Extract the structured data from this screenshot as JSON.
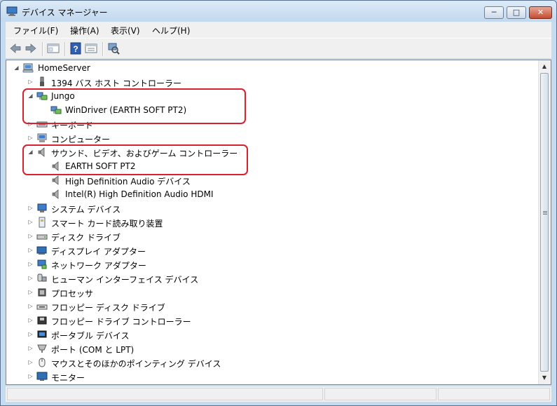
{
  "window": {
    "title": "デバイス マネージャー",
    "minimize_glyph": "─",
    "maximize_glyph": "□",
    "close_glyph": "✕"
  },
  "menu": [
    "ファイル(F)",
    "操作(A)",
    "表示(V)",
    "ヘルプ(H)"
  ],
  "toolbar": {
    "buttons": [
      "back-arrow-icon",
      "forward-arrow-icon",
      "console-tree-icon",
      "help-icon",
      "properties-icon",
      "scan-hardware-icon"
    ]
  },
  "tree": {
    "root": "HomeServer",
    "items": [
      {
        "label": "1394 バス ホスト コントローラー",
        "level": 1,
        "expander": "▷",
        "icon": "bus-controller-icon"
      },
      {
        "label": "Jungo",
        "level": 1,
        "expander": "◢",
        "icon": "network-icon"
      },
      {
        "label": "WinDriver (EARTH SOFT PT2)",
        "level": 2,
        "expander": "",
        "icon": "network-icon"
      },
      {
        "label": "キーボード",
        "level": 1,
        "expander": "▷",
        "icon": "keyboard-icon"
      },
      {
        "label": "コンピューター",
        "level": 1,
        "expander": "▷",
        "icon": "computer-icon"
      },
      {
        "label": "サウンド、ビデオ、およびゲーム コントローラー",
        "level": 1,
        "expander": "◢",
        "icon": "speaker-icon"
      },
      {
        "label": "EARTH SOFT PT2",
        "level": 2,
        "expander": "",
        "icon": "speaker-icon"
      },
      {
        "label": "High Definition Audio デバイス",
        "level": 2,
        "expander": "",
        "icon": "speaker-icon"
      },
      {
        "label": "Intel(R) High Definition Audio HDMI",
        "level": 2,
        "expander": "",
        "icon": "speaker-icon"
      },
      {
        "label": "システム デバイス",
        "level": 1,
        "expander": "▷",
        "icon": "system-device-icon"
      },
      {
        "label": "スマート カード読み取り装置",
        "level": 1,
        "expander": "▷",
        "icon": "smartcard-icon"
      },
      {
        "label": "ディスク ドライブ",
        "level": 1,
        "expander": "▷",
        "icon": "disk-drive-icon"
      },
      {
        "label": "ディスプレイ アダプター",
        "level": 1,
        "expander": "▷",
        "icon": "display-adapter-icon"
      },
      {
        "label": "ネットワーク アダプター",
        "level": 1,
        "expander": "▷",
        "icon": "network-adapter-icon"
      },
      {
        "label": "ヒューマン インターフェイス デバイス",
        "level": 1,
        "expander": "▷",
        "icon": "hid-icon"
      },
      {
        "label": "プロセッサ",
        "level": 1,
        "expander": "▷",
        "icon": "processor-icon"
      },
      {
        "label": "フロッピー ディスク ドライブ",
        "level": 1,
        "expander": "▷",
        "icon": "floppy-drive-icon"
      },
      {
        "label": "フロッピー ドライブ コントローラー",
        "level": 1,
        "expander": "▷",
        "icon": "floppy-controller-icon"
      },
      {
        "label": "ポータブル デバイス",
        "level": 1,
        "expander": "▷",
        "icon": "portable-device-icon"
      },
      {
        "label": "ポート (COM と LPT)",
        "level": 1,
        "expander": "▷",
        "icon": "port-icon"
      },
      {
        "label": "マウスとそのほかのポインティング デバイス",
        "level": 1,
        "expander": "▷",
        "icon": "mouse-icon"
      },
      {
        "label": "モニター",
        "level": 1,
        "expander": "▷",
        "icon": "monitor-icon"
      }
    ]
  },
  "scrollbar": {
    "up_glyph": "▲",
    "down_glyph": "▼"
  },
  "annotation_color": "#d8202f"
}
